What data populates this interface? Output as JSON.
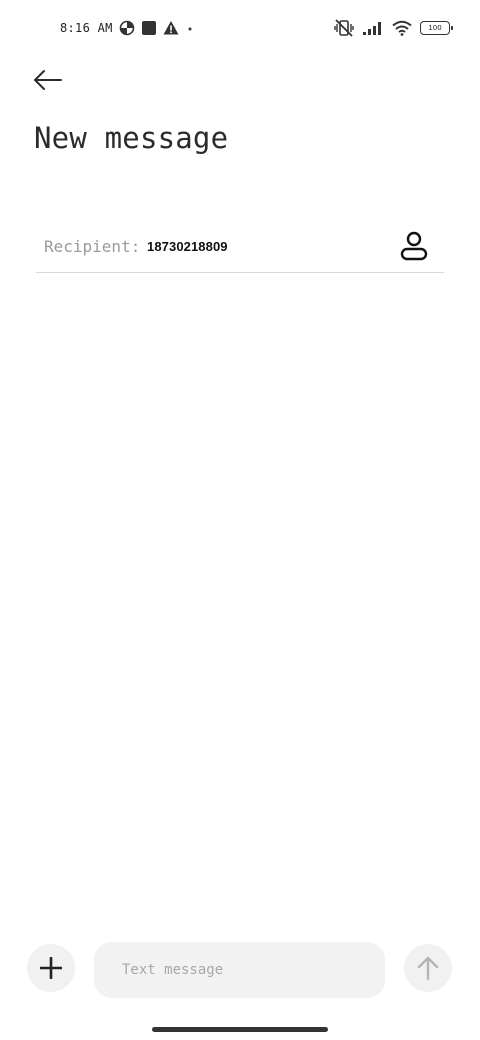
{
  "status_bar": {
    "time": "8:16 AM",
    "left_icons": [
      "data-saver-icon",
      "square-notification-icon",
      "warning-icon",
      "dot-icon"
    ],
    "right_icons": [
      "vibrate-off-icon",
      "signal-icon",
      "wifi-icon",
      "battery-icon"
    ],
    "battery_level": "100"
  },
  "header": {
    "back_icon": "arrow-left-icon",
    "title": "New message"
  },
  "recipient": {
    "label": "Recipient:",
    "value": "18730218809",
    "contact_icon": "person-icon"
  },
  "composer": {
    "attach_icon": "plus-icon",
    "placeholder": "Text message",
    "value": "",
    "send_icon": "arrow-up-icon"
  },
  "colors": {
    "background": "#ffffff",
    "title": "#2b2b2b",
    "muted": "#9a9a9a",
    "composer_bg": "#f2f2f2",
    "send_disabled": "#b5b5b5"
  }
}
